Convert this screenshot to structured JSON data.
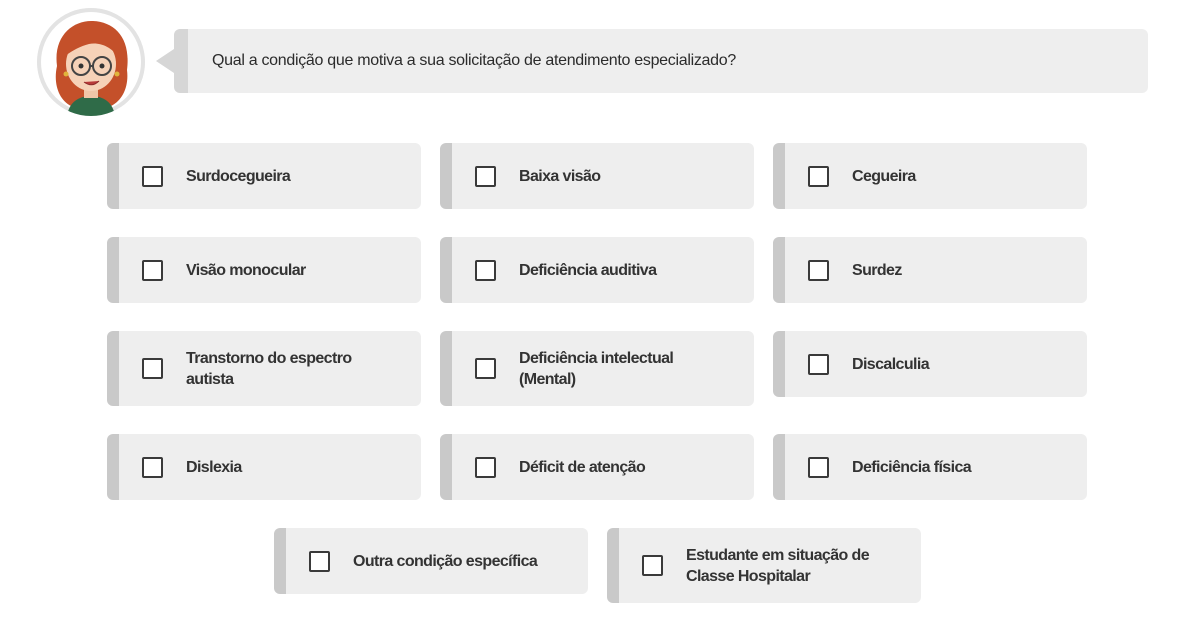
{
  "question": "Qual a condição que motiva a sua solicitação de atendimento especializado?",
  "colors": {
    "option_background": "#eeeeee",
    "option_accent": "#c9c9c9",
    "bubble_background": "#eeeeee",
    "text": "#333333"
  },
  "avatar_icon": "cartoon-woman-with-glasses",
  "options": [
    {
      "label": "Surdocegueira",
      "checked": false
    },
    {
      "label": "Baixa visão",
      "checked": false
    },
    {
      "label": "Cegueira",
      "checked": false
    },
    {
      "label": "Visão monocular",
      "checked": false
    },
    {
      "label": "Deficiência auditiva",
      "checked": false
    },
    {
      "label": "Surdez",
      "checked": false
    },
    {
      "label": "Transtorno do espectro\nautista",
      "checked": false
    },
    {
      "label": "Deficiência intelectual\n(Mental)",
      "checked": false
    },
    {
      "label": "Discalculia",
      "checked": false
    },
    {
      "label": "Dislexia",
      "checked": false
    },
    {
      "label": "Déficit de atenção",
      "checked": false
    },
    {
      "label": "Deficiência física",
      "checked": false
    },
    {
      "label": "Outra condição específica",
      "checked": false
    },
    {
      "label": "Estudante em situação de\nClasse Hospitalar",
      "checked": false
    }
  ]
}
